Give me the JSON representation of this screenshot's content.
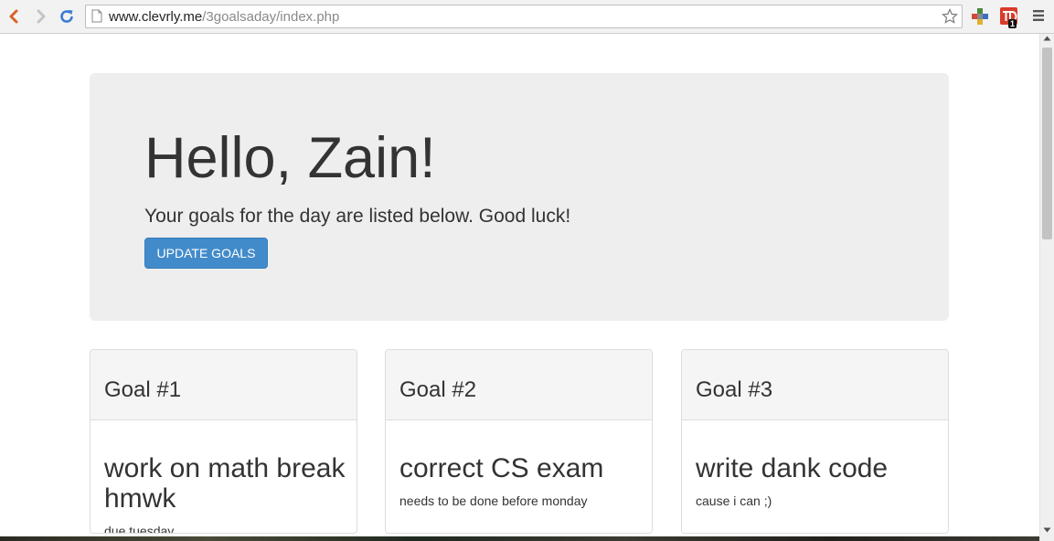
{
  "browser": {
    "url_host": "www.clevrly.me",
    "url_path": "/3goalsaday/index.php",
    "extension_badge": "1",
    "icons": [
      "back-icon",
      "forward-icon",
      "reload-icon",
      "page-icon",
      "star-icon",
      "extension-icon",
      "extension-td-icon",
      "menu-icon"
    ]
  },
  "hero": {
    "greeting": "Hello, Zain!",
    "subtitle": "Your goals for the day are listed below. Good luck!",
    "button_label": "UPDATE GOALS"
  },
  "goals": [
    {
      "title": "Goal #1",
      "goal": "work on math break hmwk",
      "note": "due tuesday"
    },
    {
      "title": "Goal #2",
      "goal": "correct CS exam",
      "note": "needs to be done before monday"
    },
    {
      "title": "Goal #3",
      "goal": "write dank code",
      "note": "cause i can ;)"
    }
  ],
  "colors": {
    "primary_button": "#428bca",
    "hero_background": "#eeeeee",
    "panel_heading": "#f5f5f5",
    "text": "#333333"
  }
}
